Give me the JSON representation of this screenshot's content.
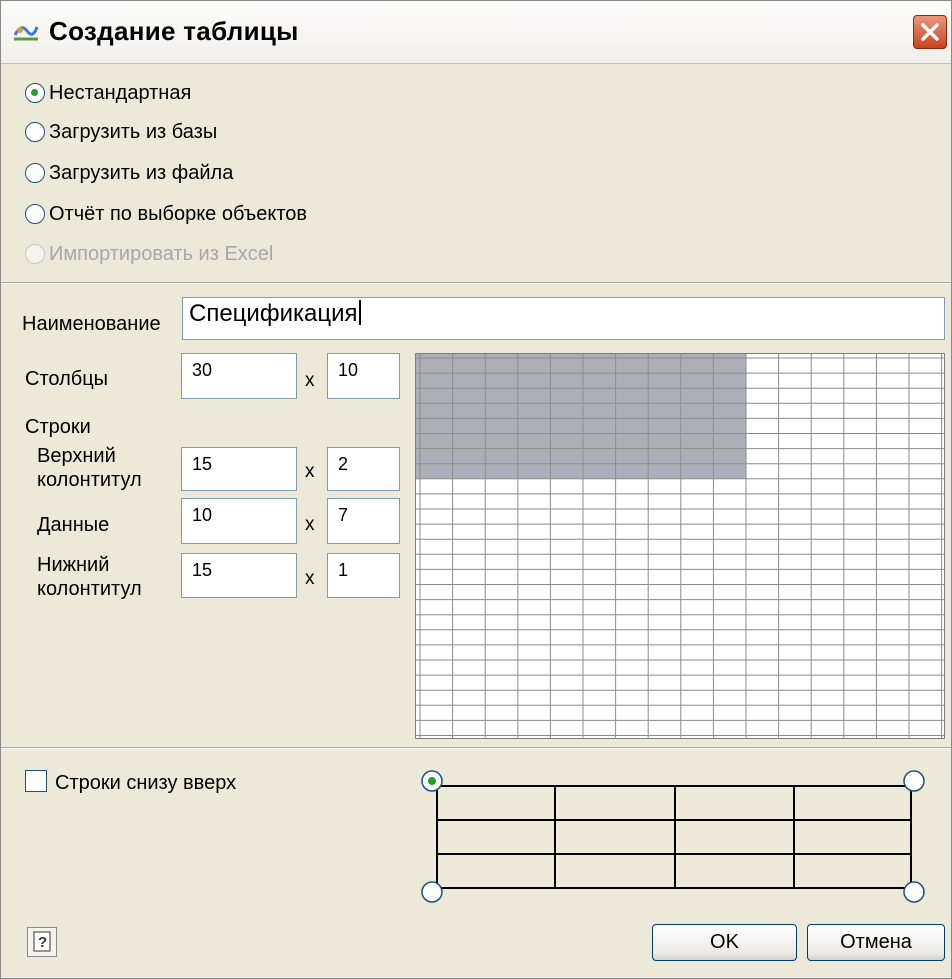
{
  "window": {
    "title": "Создание таблицы"
  },
  "source_options": [
    {
      "label": "Нестандартная",
      "checked": true,
      "disabled": false
    },
    {
      "label": "Загрузить из базы",
      "checked": false,
      "disabled": false
    },
    {
      "label": "Загрузить из файла",
      "checked": false,
      "disabled": false
    },
    {
      "label": "Отчёт по выборке объектов",
      "checked": false,
      "disabled": false
    },
    {
      "label": "Импортировать из Excel",
      "checked": false,
      "disabled": true
    }
  ],
  "form": {
    "name_label": "Наименование",
    "name_value": "Спецификация",
    "columns_label": "Столбцы",
    "columns_count": "30",
    "columns_width": "10",
    "rows_label": "Строки",
    "header_label": "Верхний колонтитул",
    "header_rows": "15",
    "header_height": "2",
    "data_label": "Данные",
    "data_rows": "10",
    "data_height": "7",
    "footer_label": "Нижний колонтитул",
    "footer_rows": "15",
    "footer_height": "1",
    "x_sign": "x"
  },
  "preview": {
    "total_columns": 16,
    "total_rows": 25,
    "highlight_columns": 10,
    "highlight_rows": 8,
    "highlight_color": "#aeaeb8",
    "line_color": "#8c8c8c"
  },
  "bottom_up": {
    "label": "Строки снизу вверх",
    "checked": false
  },
  "buttons": {
    "ok": "OK",
    "cancel": "Отмена"
  }
}
